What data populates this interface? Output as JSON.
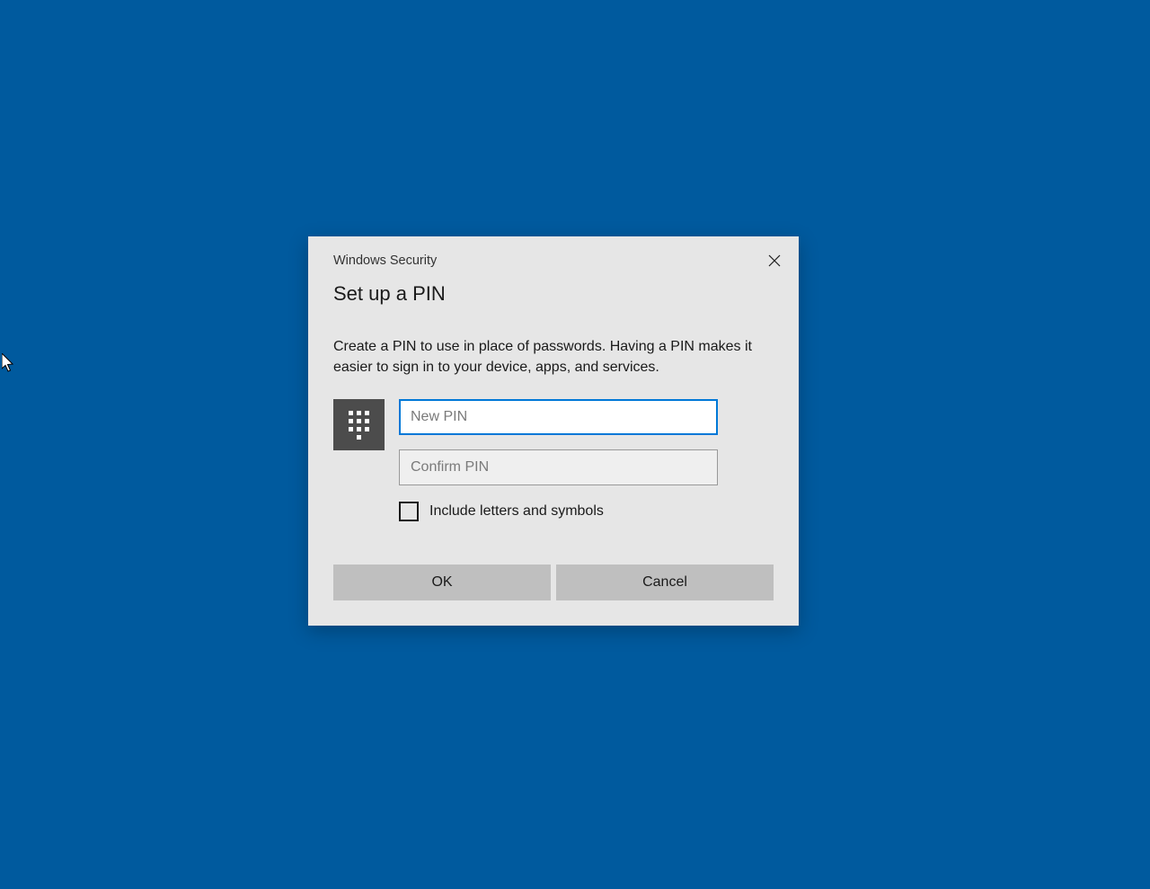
{
  "dialog": {
    "app_title": "Windows Security",
    "title": "Set up a PIN",
    "description": "Create a PIN to use in place of passwords. Having a PIN makes it easier to sign in to your device, apps, and services.",
    "new_pin_placeholder": "New PIN",
    "new_pin_value": "",
    "confirm_pin_placeholder": "Confirm PIN",
    "confirm_pin_value": "",
    "include_symbols_label": "Include letters and symbols",
    "include_symbols_checked": false,
    "ok_label": "OK",
    "cancel_label": "Cancel"
  }
}
